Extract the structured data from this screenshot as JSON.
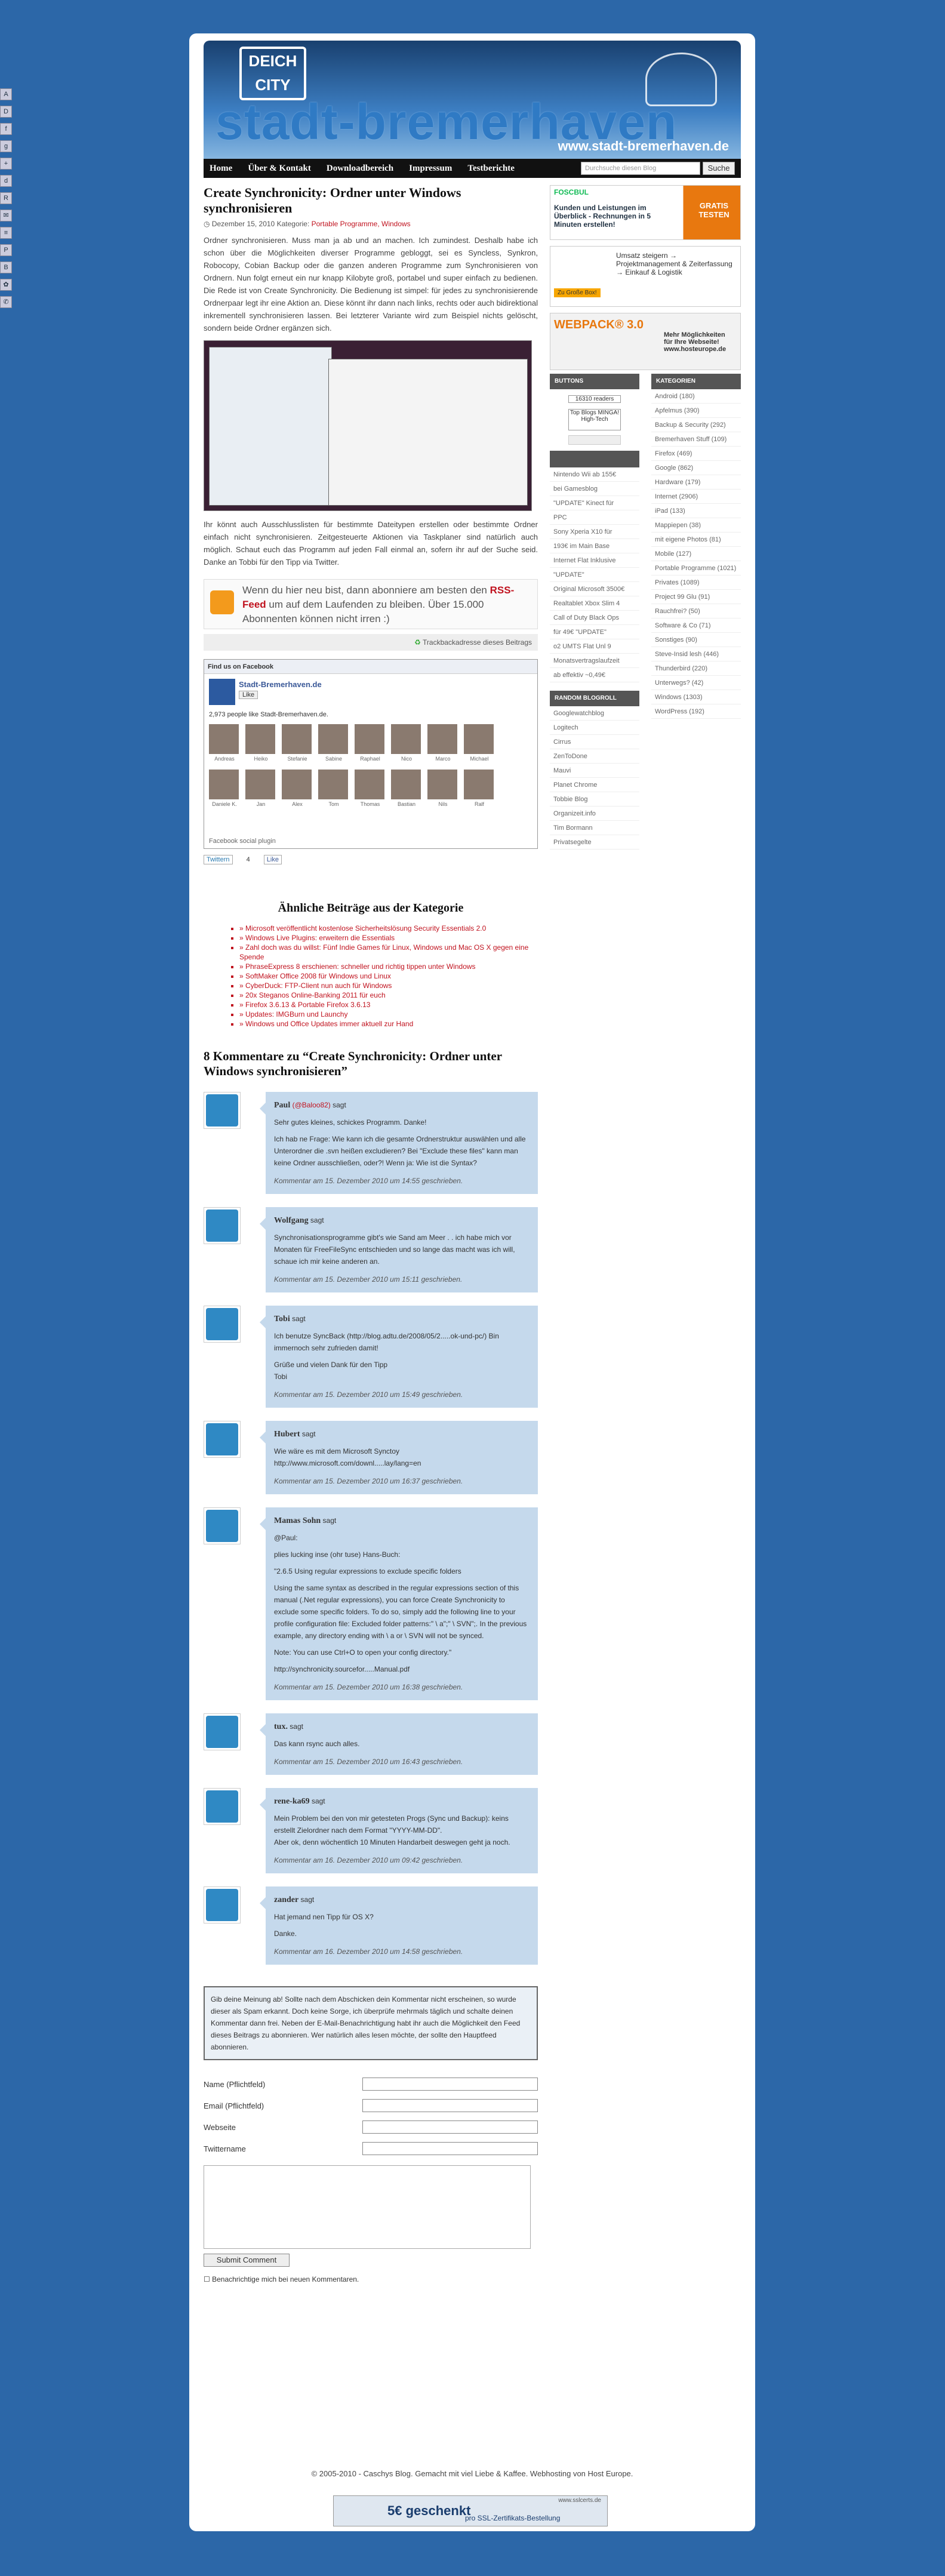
{
  "social": [
    "A",
    "D",
    "f",
    "g",
    "+",
    "d",
    "R",
    "✉",
    "≡",
    "P",
    "B",
    "✿",
    "✆"
  ],
  "header": {
    "logo_top": "DEICH",
    "logo_bottom": "CITY",
    "title": "stadt-bremerhaven",
    "domain": "www.stadt-bremerhaven.de",
    "nav": [
      "Home",
      "Über & Kontakt",
      "Downloadbereich",
      "Impressum",
      "Testberichte"
    ],
    "search_placeholder": "Durchsuche diesen Blog",
    "search_button": "Suche"
  },
  "post": {
    "title": "Create Synchronicity: Ordner unter Windows synchronisieren",
    "meta_date": "Dezember 15, 2010",
    "meta_cat_label": "Kategorie:",
    "meta_cats": "Portable Programme, Windows",
    "p1": "Ordner synchronisieren. Muss man ja ab und an machen. Ich zumindest. Deshalb habe ich schon über die Möglichkeiten diverser Programme gebloggt, sei es Syncless, Synkron, Robocopy, Cobian Backup oder die ganzen anderen Programme zum Synchronisieren von Ordnern. Nun folgt erneut ein nur knapp Kilobyte groß, portabel und super einfach zu bedienen. Die Rede ist von Create Synchronicity. Die Bedienung ist simpel: für jedes zu synchronisierende Ordnerpaar legt ihr eine Aktion an. Diese könnt ihr dann nach links, rechts oder auch bidirektional inkrementell synchronisieren lassen. Bei letzterer Variante wird zum Beispiel nichts gelöscht, sondern beide Ordner ergänzen sich.",
    "p2": "Ihr könnt auch Ausschlusslisten für bestimmte Dateitypen erstellen oder bestimmte Ordner einfach nicht synchronisieren. Zeitgesteuerte Aktionen via Taskplaner sind natürlich auch möglich. Schaut euch das Programm auf jeden Fall einmal an, sofern ihr auf der Suche seid. Danke an Tobbi für den Tipp via Twitter.",
    "rss_text_1": "Wenn du hier neu bist, dann abonniere am besten den",
    "rss_link": "RSS-Feed",
    "rss_text_2": "um auf dem Laufenden zu bleiben. Über 15.000 Abonnenten können nicht irren :)",
    "trackback": "Trackbackadresse dieses Beitrags",
    "twitter_label": "Twittern",
    "twitter_count": "4",
    "like_label": "Like"
  },
  "facebook": {
    "header": "Find us on Facebook",
    "page": "Stadt-Bremerhaven.de",
    "like": "Like",
    "count_text": "2,973 people like Stadt-Bremerhaven.de.",
    "people": [
      "Andreas",
      "Heiko",
      "Stefanie",
      "Sabine",
      "Raphael",
      "Nico",
      "Marco",
      "Michael",
      "Daniele K.",
      "Jan",
      "Alex",
      "Tom",
      "Thomas",
      "Bastian",
      "Nils",
      "Ralf"
    ],
    "footer": "Facebook social plugin"
  },
  "similar": {
    "title": "Ähnliche Beiträge aus der Kategorie",
    "items": [
      "» Microsoft veröffentlicht kostenlose Sicherheitslösung Security Essentials 2.0",
      "» Windows Live Plugins: erweitern die Essentials",
      "» Zahl doch was du willst: Fünf Indie Games für Linux, Windows und Mac OS X gegen eine Spende",
      "» PhraseExpress 8 erschienen: schneller und richtig tippen unter Windows",
      "» SoftMaker Office 2008 für Windows und Linux",
      "» CyberDuck: FTP-Client nun auch für Windows",
      "» 20x Steganos Online-Banking 2011 für euch",
      "» Firefox 3.6.13 & Portable Firefox 3.6.13",
      "» Updates: IMGBurn und Launchy",
      "» Windows und Office Updates immer aktuell zur Hand"
    ]
  },
  "comments_title": "8 Kommentare zu “Create Synchronicity: Ordner unter Windows synchronisieren”",
  "comments": [
    {
      "name": "Paul",
      "tw": "(@Baloo82)",
      "says": "sagt",
      "text": "Sehr gutes kleines, schickes Programm. Danke!\n\nIch hab ne Frage: Wie kann ich die gesamte Ordnerstruktur auswählen und alle Unterordner die .svn heißen excludieren? Bei \"Exclude these files\" kann man keine Ordner ausschließen, oder?! Wenn ja: Wie ist die Syntax?",
      "date": "Kommentar am 15. Dezember 2010 um 14:55 geschrieben."
    },
    {
      "name": "Wolfgang",
      "tw": "",
      "says": "sagt",
      "text": "Synchronisationsprogramme gibt's wie Sand am Meer . . ich habe mich vor Monaten für FreeFileSync entschieden und so lange das macht was ich will, schaue ich mir keine anderen an.",
      "date": "Kommentar am 15. Dezember 2010 um 15:11 geschrieben."
    },
    {
      "name": "Tobi",
      "tw": "",
      "says": "sagt",
      "text": "Ich benutze SyncBack (http://blog.adtu.de/2008/05/2.....ok-und-pc/) Bin immernoch sehr zufrieden damit!\n\nGrüße und vielen Dank für den Tipp\nTobi",
      "date": "Kommentar am 15. Dezember 2010 um 15:49 geschrieben."
    },
    {
      "name": "Hubert",
      "tw": "",
      "says": "sagt",
      "text": "Wie wäre es mit dem Microsoft Synctoy\nhttp://www.microsoft.com/downl.....lay/lang=en",
      "date": "Kommentar am 15. Dezember 2010 um 16:37 geschrieben."
    },
    {
      "name": "Mamas Sohn",
      "tw": "",
      "says": "sagt",
      "text": "@Paul:\n\nplies lucking inse (ohr tuse) Hans-Buch:\n\n\"2.6.5 Using regular expressions to exclude specific folders\n\nUsing the same syntax as described in the regular expressions section of this manual (.Net regular expressions), you can force Create Synchronicity to exclude some specific folders. To do so, simply add the following line to your profile configuration file: Excluded folder patterns:\" \\ a\";\" \\ SVN\";. In the previous example, any directory ending with \\ a or \\ SVN will not be synced.\n\nNote: You can use Ctrl+O to open your config directory.\"\n\nhttp://synchronicity.sourcefor.....Manual.pdf",
      "date": "Kommentar am 15. Dezember 2010 um 16:38 geschrieben."
    },
    {
      "name": "tux.",
      "tw": "",
      "says": "sagt",
      "text": "Das kann rsync auch alles.",
      "date": "Kommentar am 15. Dezember 2010 um 16:43 geschrieben."
    },
    {
      "name": "rene-ka69",
      "tw": "",
      "says": "sagt",
      "text": "Mein Problem bei den von mir getesteten Progs (Sync und Backup): keins erstellt Zielordner nach dem Format \"YYYY-MM-DD\".\nAber ok, denn wöchentlich 10 Minuten Handarbeit deswegen geht ja noch.",
      "date": "Kommentar am 16. Dezember 2010 um 09:42 geschrieben."
    },
    {
      "name": "zander",
      "tw": "",
      "says": "sagt",
      "text": "Hat jemand nen Tipp für OS X?\n\nDanke.",
      "date": "Kommentar am 16. Dezember 2010 um 14:58 geschrieben."
    }
  ],
  "notice": "Gib deine Meinung ab! Sollte nach dem Abschicken dein Kommentar nicht erscheinen, so wurde dieser als Spam erkannt. Doch keine Sorge, ich überprüfe mehrmals täglich und schalte deinen Kommentar dann frei. Neben der E-Mail-Benachrichtigung habt ihr auch die Möglichkeit den Feed dieses Beitrags zu abonnieren. Wer natürlich alles lesen möchte, der sollte den Hauptfeed abonnieren.",
  "form": {
    "fields": [
      "Name (Pflichtfeld)",
      "Email (Pflichtfeld)",
      "Webseite",
      "Twittername"
    ],
    "submit": "Submit Comment",
    "notify": "Benachrichtige mich bei neuen Kommentaren."
  },
  "sidebar": {
    "ad1_title": "FOSCBUL",
    "ad1_text": "Kunden und Leistungen im Überblick - Rechnungen in 5 Minuten erstellen!",
    "ad1_badge": "GRATIS TESTEN",
    "ad2_text": "Umsatz steigern → Projektmanagement & Zeiterfassung → Einkauf & Logistik",
    "ad2_btn": "Zu Große Box!",
    "ad3_title": "WEBPACK® 3.0",
    "ad3_text": "Mehr Möglichkeiten für Ihre Webseite! www.hosteurope.de",
    "buttons_header": "BUTTONS",
    "readers": "16310 readers",
    "topblogs": "Top Blogs MINGA! High-Tech",
    "left_list": [
      "Nintendo Wii ab 155€",
      "bei Gamesblog",
      "\"UPDATE\" Kinect für",
      "PPC",
      "Sony Xperia X10 für",
      "193€ im Main Base",
      "Internet Flat Inklusive",
      "\"UPDATE\"",
      "Original Microsoft 3500€",
      "Realtablet Xbox Slim 4",
      "Call of Duty Black Ops",
      "für 49€ \"UPDATE\"",
      "o2 UMTS Flat Unl 9",
      "Monatsvertragslaufzeit",
      "ab effektiv ~0,49€"
    ],
    "random_header": "RANDOM BLOGROLL",
    "random": [
      "Googlewatchblog",
      "Logitech",
      "Cirrus",
      "ZenToDone",
      "Mauvi",
      "Planet Chrome",
      "Tobbie Blog",
      "Organizeit.info",
      "Tim Bormann",
      "Privatsegelte"
    ],
    "cat_header": "KATEGORIEN",
    "cats": [
      "Android (180)",
      "Apfelmus (390)",
      "Backup & Security (292)",
      "Bremerhaven Stuff (109)",
      "Firefox (469)",
      "Google (862)",
      "Hardware (179)",
      "Internet (2906)",
      "iPad (133)",
      "Mappiepen (38)",
      "mit eigene Photos (81)",
      "Mobile (127)",
      "Portable Programme (1021)",
      "Privates (1089)",
      "Project 99 Glu (91)",
      "Rauchfrei? (50)",
      "Software & Co (71)",
      "Sonstiges (90)",
      "Steve-Insid lesh (446)",
      "Thunderbird (220)",
      "Unterwegs? (42)",
      "Windows (1303)",
      "WordPress (192)"
    ]
  },
  "footer": "© 2005-2010 - Caschys Blog. Gemacht mit viel Liebe & Kaffee. Webhosting von Host Europe.",
  "banner": {
    "top": "www.sslcerts.de",
    "text": "5€ geschenkt",
    "sub": "pro SSL-Zertifikats-Bestellung"
  }
}
